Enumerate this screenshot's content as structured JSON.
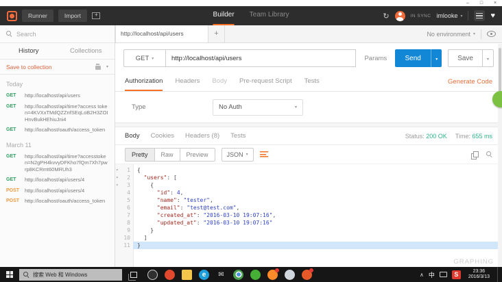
{
  "window_controls": {
    "minimize": "–",
    "maximize": "□",
    "close": "×"
  },
  "appbar": {
    "runner_label": "Runner",
    "import_label": "Import",
    "nav_tabs": [
      {
        "label": "Builder",
        "active": true
      },
      {
        "label": "Team Library",
        "active": false
      }
    ],
    "sync_status": "IN SYNC",
    "username": "imlooke"
  },
  "sidebar": {
    "search_placeholder": "Search",
    "tabs": [
      {
        "label": "History",
        "active": true
      },
      {
        "label": "Collections",
        "active": false
      }
    ],
    "save_to_collection": "Save to collection",
    "groups": [
      {
        "title": "Today",
        "items": [
          {
            "method": "GET",
            "url": "http://localhost/api/users"
          },
          {
            "method": "GET",
            "url": "http://localhost/api/time?access token=4KVXxTMdQZZnfSEqLoB2H3ZOIHnvBukHEhiuJni4"
          },
          {
            "method": "GET",
            "url": "http://localhost/oauth/access_token"
          }
        ]
      },
      {
        "title": "March 11",
        "items": [
          {
            "method": "GET",
            "url": "http://localhost/api/time?accesstoken=N2gPH4kvvyDFKho7fQm7Xh7pwrp8KCRmt60MRUh3"
          },
          {
            "method": "GET",
            "url": "http://localhost/api/users/4"
          },
          {
            "method": "POST",
            "url": "http://localhost/api/users/4"
          },
          {
            "method": "POST",
            "url": "http://localhost/oauth/access_token"
          }
        ]
      }
    ]
  },
  "request": {
    "tab_title": "http://localhost/api/users",
    "new_tab": "+",
    "environment": "No environment",
    "method": "GET",
    "url": "http://localhost/api/users",
    "params_label": "Params",
    "send_label": "Send",
    "save_label": "Save",
    "tabs": [
      {
        "label": "Authorization",
        "active": true
      },
      {
        "label": "Headers",
        "active": false
      },
      {
        "label": "Body",
        "active": false,
        "dim": true
      },
      {
        "label": "Pre-request Script",
        "active": false
      },
      {
        "label": "Tests",
        "active": false
      }
    ],
    "generate_code": "Generate Code",
    "auth": {
      "type_label": "Type",
      "type_value": "No Auth"
    }
  },
  "response": {
    "tabs": [
      {
        "label": "Body",
        "active": true
      },
      {
        "label": "Cookies",
        "active": false
      },
      {
        "label": "Headers (8)",
        "active": false
      },
      {
        "label": "Tests",
        "active": false
      }
    ],
    "status_label": "Status:",
    "status_value": "200 OK",
    "time_label": "Time:",
    "time_value": "655 ms",
    "view_tabs": [
      {
        "label": "Pretty",
        "active": true
      },
      {
        "label": "Raw",
        "active": false
      },
      {
        "label": "Preview",
        "active": false
      }
    ],
    "format": "JSON",
    "code": [
      {
        "n": 1,
        "fold": true,
        "parts": [
          [
            "p",
            "{"
          ]
        ]
      },
      {
        "n": 2,
        "fold": true,
        "parts": [
          [
            "p",
            "  "
          ],
          [
            "k",
            "\"users\""
          ],
          [
            "p",
            ": ["
          ]
        ]
      },
      {
        "n": 3,
        "fold": true,
        "parts": [
          [
            "p",
            "    {"
          ]
        ]
      },
      {
        "n": 4,
        "parts": [
          [
            "p",
            "      "
          ],
          [
            "k",
            "\"id\""
          ],
          [
            "p",
            ": "
          ],
          [
            "v",
            "4"
          ],
          [
            "p",
            ","
          ]
        ]
      },
      {
        "n": 5,
        "parts": [
          [
            "p",
            "      "
          ],
          [
            "k",
            "\"name\""
          ],
          [
            "p",
            ": "
          ],
          [
            "v",
            "\"tester\""
          ],
          [
            "p",
            ","
          ]
        ]
      },
      {
        "n": 6,
        "parts": [
          [
            "p",
            "      "
          ],
          [
            "k",
            "\"email\""
          ],
          [
            "p",
            ": "
          ],
          [
            "v",
            "\"test@test.com\""
          ],
          [
            "p",
            ","
          ]
        ]
      },
      {
        "n": 7,
        "parts": [
          [
            "p",
            "      "
          ],
          [
            "k",
            "\"created_at\""
          ],
          [
            "p",
            ": "
          ],
          [
            "v",
            "\"2016-03-10 19:07:16\""
          ],
          [
            "p",
            ","
          ]
        ]
      },
      {
        "n": 8,
        "parts": [
          [
            "p",
            "      "
          ],
          [
            "k",
            "\"updated_at\""
          ],
          [
            "p",
            ": "
          ],
          [
            "v",
            "\"2016-03-10 19:07:16\""
          ]
        ]
      },
      {
        "n": 9,
        "parts": [
          [
            "p",
            "    }"
          ]
        ]
      },
      {
        "n": 10,
        "parts": [
          [
            "p",
            "  ]"
          ]
        ]
      },
      {
        "n": 11,
        "highlight": true,
        "parts": [
          [
            "p",
            "}"
          ]
        ]
      }
    ]
  },
  "taskbar": {
    "search_text": "搜索 Web 和 Windows",
    "apps": [
      {
        "name": "messaging-app",
        "color": "#2f2f2f",
        "border": "#cfcfcf"
      },
      {
        "name": "red-app",
        "color": "#e0492e"
      },
      {
        "name": "file-explorer",
        "color": "#f3c64b",
        "shape": "folder"
      },
      {
        "name": "edge-browser",
        "color": "#1d9dd9",
        "glyph": "e"
      },
      {
        "name": "mail-app",
        "glyph": "✉",
        "flat": true,
        "color": "#dddddd"
      },
      {
        "name": "chrome-browser",
        "color": "#4a9e4f",
        "chrome": true
      },
      {
        "name": "green-app",
        "color": "#45b035"
      },
      {
        "name": "firefox-browser",
        "color": "#ff8a2a",
        "badge": true
      },
      {
        "name": "photos-app",
        "color": "#cfd6dd"
      },
      {
        "name": "orange-app",
        "color": "#e8592a",
        "badge": true
      }
    ],
    "tray": {
      "expand": "∧",
      "ime": "中",
      "sogou": "S",
      "time": "23:36",
      "date": "2016/3/13"
    }
  },
  "watermark": "GRAPHING"
}
